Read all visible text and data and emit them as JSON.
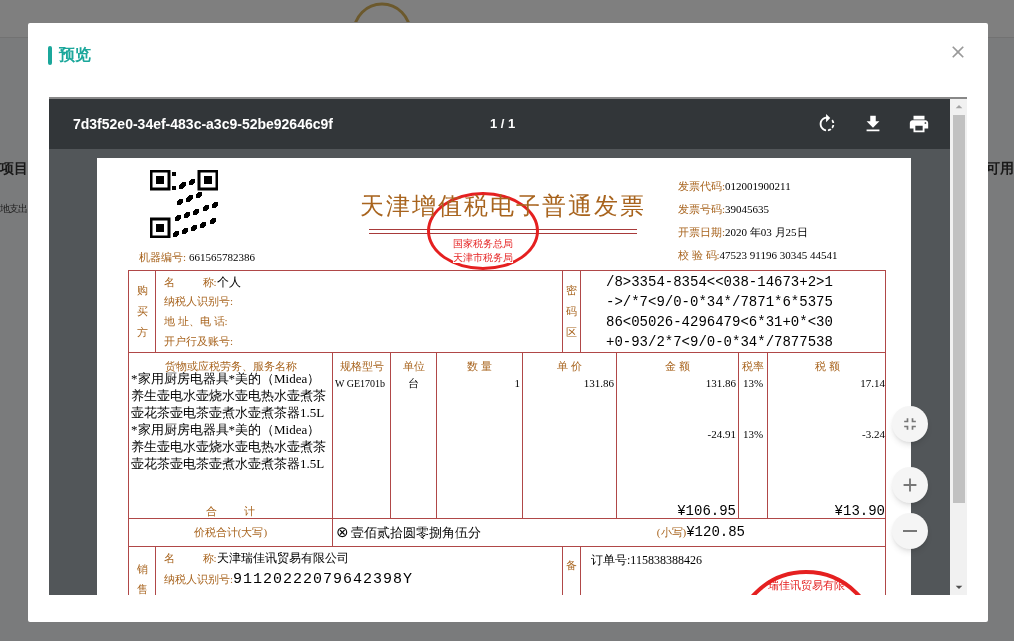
{
  "background": {
    "left_labels": [
      "项目",
      "地支出"
    ],
    "right_label": "可用"
  },
  "modal": {
    "title": "预览"
  },
  "viewer": {
    "file_name": "7d3f52e0-34ef-483c-a3c9-52be92646c9f",
    "page": "1 / 1"
  },
  "invoice": {
    "title": "天津增值税电子普通发票",
    "machine_no": {
      "label": "机器编号:",
      "value": "661565782386"
    },
    "meta": [
      {
        "label": "发票代码:",
        "value": "012001900211"
      },
      {
        "label": "发票号码:",
        "value": "39045635"
      },
      {
        "label": "开票日期:",
        "value": "2020 年03 月25日"
      },
      {
        "label": "校 验 码:",
        "value": "47523 91196 30345 44541"
      }
    ],
    "tax_seal": [
      "国家税务总局",
      "天津市税务局"
    ],
    "buyer": {
      "label": "购买方",
      "fields": [
        {
          "label": "名          称:",
          "value": "个人"
        },
        {
          "label": "纳税人识别号:"
        },
        {
          "label": "地 址、电 话:"
        },
        {
          "label": "开户行及账号:"
        }
      ]
    },
    "cipher": {
      "label": "密码区",
      "lines": [
        "/8>3354-8354<<038-14673+2>1",
        "->/*7<9/0-0*34*/7871*6*5375",
        "86<05026-4296479<6*31+0*<30",
        "+0-93/2*7<9/0-0*34*/7877538"
      ]
    },
    "columns": [
      "货物或应税劳务、服务名称",
      "规格型号",
      "单位",
      "数 量",
      "单 价",
      "金 额",
      "税率",
      "税 额"
    ],
    "items": [
      {
        "name": "*家用厨房电器具*美的（Midea）养生壶电水壶烧水壶电热水壶煮茶壶花茶壶电茶壶煮水壶煮茶器1.5L",
        "spec": "W GE1701b",
        "unit": "台",
        "quantity": "1",
        "unit_price": "131.86",
        "amount": "131.86",
        "tax_rate": "13%",
        "tax": "17.14"
      },
      {
        "name": "*家用厨房电器具*美的（Midea）养生壶电水壶烧水壶电热水壶煮茶壶花茶壶电茶壶煮水壶煮茶器1.5L",
        "amount": "-24.91",
        "tax_rate": "13%",
        "tax": "-3.24"
      }
    ],
    "total": {
      "label": "合          计",
      "amount": "¥106.95",
      "tax": "¥13.90"
    },
    "grand_total": {
      "label": "价税合计(大写)",
      "mark": "⊗",
      "words": "壹佰贰拾圆零捌角伍分",
      "small_label": "(小写)",
      "value": "¥120.85"
    },
    "seller": {
      "label": "销售",
      "fields": [
        {
          "label": "名          称:",
          "value": "天津瑞佳讯贸易有限公司"
        },
        {
          "label": "纳税人识别号:",
          "value": "91120222079642398Y",
          "kind": "code"
        }
      ]
    },
    "remarks": {
      "label": "备",
      "text": "订单号:115838388426",
      "seal": "瑞佳讯贸易有限"
    }
  }
}
